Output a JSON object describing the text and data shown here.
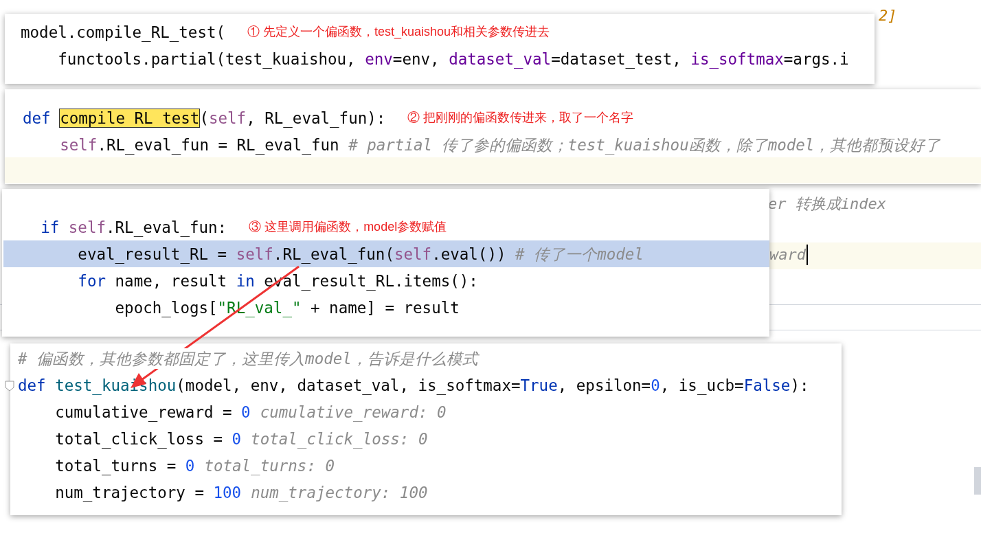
{
  "background_fragments": [
    {
      "text": "2]",
      "kind": "number"
    },
    {
      "text": "er 转换成index",
      "kind": "comment"
    },
    {
      "text": "ward",
      "kind": "comment"
    }
  ],
  "panels": [
    {
      "lines": [
        {
          "highlighted": false,
          "annotation": "① 先定义一个偏函数，test_kuaishou和相关参数传进去",
          "tokens": [
            {
              "kind": "plain",
              "text": "model.compile_RL_test("
            }
          ]
        },
        {
          "highlighted": false,
          "tokens": [
            {
              "kind": "plain",
              "text": "    functools.partial(test_kuaishou, "
            },
            {
              "kind": "named_arg",
              "text": "env"
            },
            {
              "kind": "plain",
              "text": "=env, "
            },
            {
              "kind": "named_arg",
              "text": "dataset_val"
            },
            {
              "kind": "plain",
              "text": "=dataset_test, "
            },
            {
              "kind": "named_arg",
              "text": "is_softmax"
            },
            {
              "kind": "plain",
              "text": "=args.i"
            }
          ]
        }
      ]
    },
    {
      "lines": [
        {
          "highlighted": false,
          "annotation": "② 把刚刚的偏函数传进来，取了一个名字",
          "tokens": [
            {
              "kind": "keyword",
              "text": "def "
            },
            {
              "kind": "search_hit",
              "text": "compile_RL_test"
            },
            {
              "kind": "plain",
              "text": "("
            },
            {
              "kind": "self",
              "text": "self"
            },
            {
              "kind": "plain",
              "text": ", RL_eval_fun):"
            }
          ]
        },
        {
          "highlighted": false,
          "tokens": [
            {
              "kind": "self",
              "text": "    self"
            },
            {
              "kind": "plain",
              "text": ".RL_eval_fun = RL_eval_fun "
            },
            {
              "kind": "comment",
              "text": "# partial 传了参的偏函数；test_kuaishou函数，除了model，其他都预设好了"
            }
          ]
        }
      ]
    },
    {
      "lines": [
        {
          "highlighted": false,
          "annotation": "③ 这里调用偏函数，model参数赋值",
          "tokens": [
            {
              "kind": "keyword",
              "text": "    if "
            },
            {
              "kind": "self",
              "text": "self"
            },
            {
              "kind": "plain",
              "text": ".RL_eval_fun:"
            }
          ]
        },
        {
          "highlighted": true,
          "tokens": [
            {
              "kind": "plain",
              "text": "        eval_result_RL = "
            },
            {
              "kind": "self",
              "text": "self"
            },
            {
              "kind": "plain",
              "text": ".RL_eval_fun("
            },
            {
              "kind": "self",
              "text": "self"
            },
            {
              "kind": "plain",
              "text": ".eval()) "
            },
            {
              "kind": "comment",
              "text": "# 传了一个model"
            }
          ]
        },
        {
          "highlighted": false,
          "tokens": [
            {
              "kind": "keyword",
              "text": "        for"
            },
            {
              "kind": "plain",
              "text": " name, result "
            },
            {
              "kind": "keyword",
              "text": "in"
            },
            {
              "kind": "plain",
              "text": " eval_result_RL.items():"
            }
          ]
        },
        {
          "highlighted": false,
          "tokens": [
            {
              "kind": "plain",
              "text": "            epoch_logs["
            },
            {
              "kind": "string",
              "text": "\"RL_val_\""
            },
            {
              "kind": "plain",
              "text": " + name] = result"
            }
          ]
        }
      ]
    },
    {
      "lines": [
        {
          "highlighted": false,
          "tokens": [
            {
              "kind": "comment",
              "text": "# 偏函数，其他参数都固定了，这里传入model，告诉是什么模式"
            }
          ]
        },
        {
          "highlighted": false,
          "tokens": [
            {
              "kind": "keyword",
              "text": "def "
            },
            {
              "kind": "func",
              "text": "test_kuaishou"
            },
            {
              "kind": "plain",
              "text": "(model, env, dataset_val, is_softmax="
            },
            {
              "kind": "keyword",
              "text": "True"
            },
            {
              "kind": "plain",
              "text": ", epsilon="
            },
            {
              "kind": "number",
              "text": "0"
            },
            {
              "kind": "plain",
              "text": ", is_ucb="
            },
            {
              "kind": "keyword",
              "text": "False"
            },
            {
              "kind": "plain",
              "text": "):"
            }
          ]
        },
        {
          "highlighted": false,
          "tokens": [
            {
              "kind": "plain",
              "text": "    cumulative_reward = "
            },
            {
              "kind": "number",
              "text": "0"
            },
            {
              "kind": "hint",
              "text": "cumulative_reward: 0"
            }
          ]
        },
        {
          "highlighted": false,
          "tokens": [
            {
              "kind": "plain",
              "text": "    total_click_loss = "
            },
            {
              "kind": "number",
              "text": "0"
            },
            {
              "kind": "hint",
              "text": "total_click_loss: 0"
            }
          ]
        },
        {
          "highlighted": false,
          "tokens": [
            {
              "kind": "plain",
              "text": "    total_turns = "
            },
            {
              "kind": "number",
              "text": "0"
            },
            {
              "kind": "hint",
              "text": "total_turns: 0"
            }
          ]
        },
        {
          "highlighted": false,
          "tokens": [
            {
              "kind": "plain",
              "text": "    num_trajectory = "
            },
            {
              "kind": "number",
              "text": "100"
            },
            {
              "kind": "hint",
              "text": "num_trajectory: 100"
            }
          ]
        }
      ]
    }
  ]
}
